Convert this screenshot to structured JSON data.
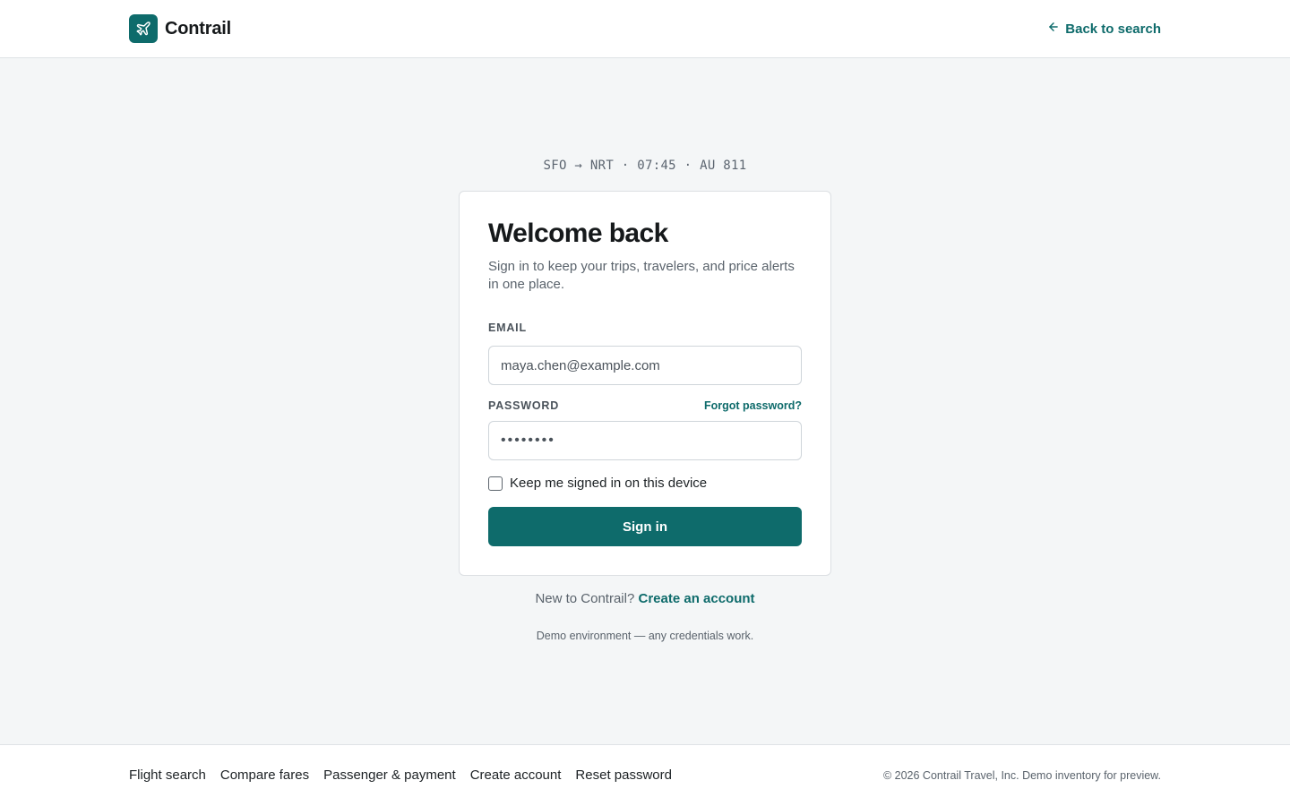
{
  "header": {
    "brand_name": "Contrail",
    "back_link": "Back to search"
  },
  "route": "SFO → NRT · 07:45 · AU 811",
  "card": {
    "title": "Welcome back",
    "subtitle": "Sign in to keep your trips, travelers, and price alerts in one place.",
    "email_label": "EMAIL",
    "email_value": "maya.chen@example.com",
    "password_label": "PASSWORD",
    "forgot_link": "Forgot password?",
    "password_value": "••••••••",
    "remember_label": "Keep me signed in on this device",
    "remember_checked": false,
    "signin_label": "Sign in"
  },
  "signup": {
    "prompt": "New to Contrail?",
    "link": "Create an account"
  },
  "demo_note": "Demo environment — any credentials work.",
  "footer": {
    "links": [
      "Flight search",
      "Compare fares",
      "Passenger & payment",
      "Create account",
      "Reset password"
    ],
    "copyright": "© 2026 Contrail Travel, Inc. Demo inventory for preview."
  },
  "colors": {
    "accent": "#0e6b6b",
    "background": "#f4f6f7"
  },
  "icons": [
    "plane-icon",
    "arrow-left-icon"
  ]
}
